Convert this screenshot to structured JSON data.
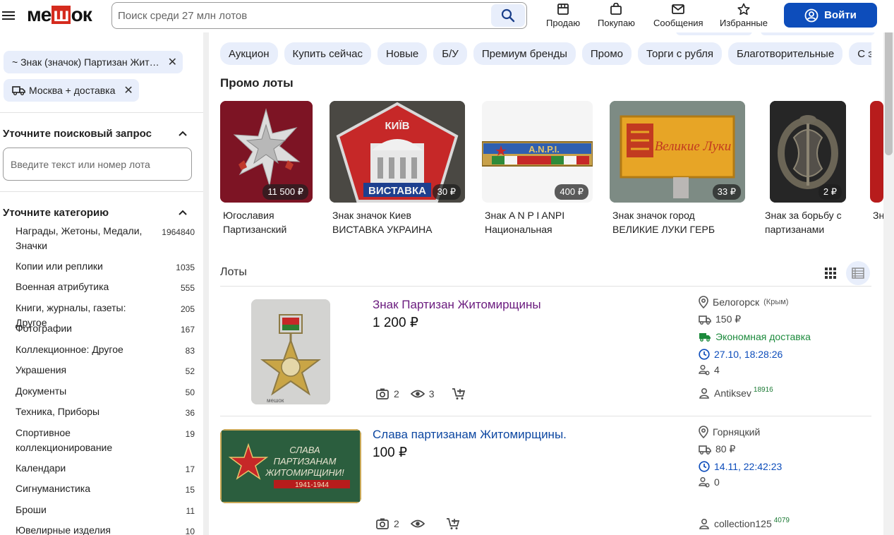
{
  "header": {
    "logo": {
      "pre": "ме",
      "mid": "ш",
      "post": "ок"
    },
    "search_placeholder": "Поиск среди 27 млн лотов",
    "nav": [
      {
        "label": "Продаю",
        "icon": "store-icon"
      },
      {
        "label": "Покупаю",
        "icon": "shopping-bag-icon"
      },
      {
        "label": "Сообщения",
        "icon": "envelope-icon"
      },
      {
        "label": "Избранные",
        "icon": "star-icon"
      }
    ],
    "login_label": "Войти"
  },
  "sidebar": {
    "chips": [
      "~ Знак (значок) Партизан Жит…",
      "Москва + доставка"
    ],
    "refine_title": "Уточните поисковый запрос",
    "refine_placeholder": "Введите текст или номер лота",
    "category_title": "Уточните категорию",
    "categories": [
      {
        "name": "Награды, Жетоны, Медали, Значки",
        "count": "1964840"
      },
      {
        "name": "Копии или реплики",
        "count": "1035"
      },
      {
        "name": "Военная атрибутика",
        "count": "555"
      },
      {
        "name": "Книги, журналы, газеты: Другое",
        "count": "205"
      },
      {
        "name": "Фотографии",
        "count": "167"
      },
      {
        "name": "Коллекционное: Другое",
        "count": "83"
      },
      {
        "name": "Украшения",
        "count": "52"
      },
      {
        "name": "Документы",
        "count": "50"
      },
      {
        "name": "Техника, Приборы",
        "count": "36"
      },
      {
        "name": "Спортивное коллекционирование",
        "count": "19"
      },
      {
        "name": "Календари",
        "count": "17"
      },
      {
        "name": "Сигнуманистика",
        "count": "15"
      },
      {
        "name": "Броши",
        "count": "11"
      },
      {
        "name": "Ювелирные изделия",
        "count": "10"
      }
    ]
  },
  "filters": [
    "Аукцион",
    "Купить сейчас",
    "Новые",
    "Б/У",
    "Премиум бренды",
    "Промо",
    "Торги с рубля",
    "Благотворительные",
    "С экс"
  ],
  "promo": {
    "title": "Промо лоты",
    "items": [
      {
        "price": "11 500 ₽",
        "title_l1": "Югославия",
        "title_l2": "Партизанский",
        "image": "yugoslav-partisan-badge"
      },
      {
        "price": "30 ₽",
        "title_l1": "Знак значок Киев",
        "title_l2": "ВИСТАВКА УКРАИНА",
        "image": "kyiv-exhibition-badge",
        "img_text_top": "КИЇВ",
        "img_text_bottom": "ВИСТАВКА"
      },
      {
        "price": "400 ₽",
        "title_l1": "Знак A N P I ANPI",
        "title_l2": "Национальная",
        "image": "anpi-badge",
        "img_text": "A.N.P.I."
      },
      {
        "price": "33 ₽",
        "title_l1": "Знак значок город",
        "title_l2": "ВЕЛИКИЕ ЛУКИ ГЕРБ",
        "image": "velikie-luki-badge",
        "img_text": "Великие Луки"
      },
      {
        "price": "2 ₽",
        "title_l1": "Знак за борьбу с",
        "title_l2": "партизанами",
        "image": "anti-partisan-badge"
      },
      {
        "price": "",
        "title_l1": "Зн",
        "title_l2": "",
        "image": "partial-item"
      }
    ]
  },
  "lots": {
    "title": "Лоты",
    "items": [
      {
        "title": "Знак Партизан Житомирщины",
        "title_color": "#6a1b7e",
        "price": "1 200 ₽",
        "location": "Белогорск",
        "region": "(Крым)",
        "shipping": "150 ₽",
        "eco_delivery": "Экономная доставка",
        "end_time": "27.10, 18:28:26",
        "bids": "4",
        "seller": "Antiksev",
        "seller_rating": "18916",
        "photos": "2",
        "views": "3",
        "image": "partisan-star-medal",
        "watermark": "мешок"
      },
      {
        "title": "Слава партизанам Житомирщины.",
        "title_color": "#0d47a1",
        "price": "100 ₽",
        "location": "Горняцкий",
        "shipping": "80 ₽",
        "end_time": "14.11, 22:42:23",
        "bids": "0",
        "seller": "collection125",
        "seller_rating": "4079",
        "photos": "2",
        "views": "",
        "image": "glory-partisans-badge",
        "img_text_l1": "СЛАВА",
        "img_text_l2": "ПАРТИЗАНАМ",
        "img_text_l3": "ЖИТОМИРЩИНИ!",
        "img_text_l4": "1941-1944"
      }
    ]
  },
  "colors": {
    "accent": "#0d4dbb",
    "chip_bg": "#e8eefb",
    "eco_green": "#1c8a3c",
    "time_blue": "#0d4dbb",
    "logo_red": "#d52b1e"
  }
}
